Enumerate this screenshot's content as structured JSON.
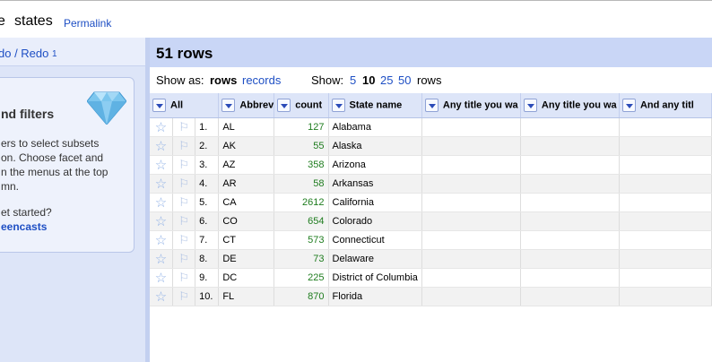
{
  "header": {
    "title_fragment": "e",
    "project_name": "states",
    "permalink_label": "Permalink"
  },
  "left": {
    "undo_redo_label": "do / Redo",
    "undo_count": "1",
    "facet_title": "nd filters",
    "facet_desc_lines": [
      "ers to select subsets",
      " on. Choose facet and",
      "n the menus at the top",
      "mn."
    ],
    "started_text": "et started?",
    "screencasts_label": "eencasts"
  },
  "main": {
    "rows_title": "51 rows",
    "show_as_label": "Show as:",
    "show_as_rows": "rows",
    "show_as_records": "records",
    "show_label": "Show:",
    "page_sizes": [
      "5",
      "10",
      "25",
      "50"
    ],
    "selected_page_size": "10",
    "rows_suffix": "rows"
  },
  "table": {
    "columns": [
      "All",
      "Abbrev",
      "count",
      "State name",
      "Any title you wa",
      "Any title you wa",
      "And any titl"
    ],
    "rows": [
      {
        "index": "1.",
        "abbrev": "AL",
        "count": "127",
        "state": "Alabama"
      },
      {
        "index": "2.",
        "abbrev": "AK",
        "count": "55",
        "state": "Alaska"
      },
      {
        "index": "3.",
        "abbrev": "AZ",
        "count": "358",
        "state": "Arizona"
      },
      {
        "index": "4.",
        "abbrev": "AR",
        "count": "58",
        "state": "Arkansas"
      },
      {
        "index": "5.",
        "abbrev": "CA",
        "count": "2612",
        "state": "California"
      },
      {
        "index": "6.",
        "abbrev": "CO",
        "count": "654",
        "state": "Colorado"
      },
      {
        "index": "7.",
        "abbrev": "CT",
        "count": "573",
        "state": "Connecticut"
      },
      {
        "index": "8.",
        "abbrev": "DE",
        "count": "73",
        "state": "Delaware"
      },
      {
        "index": "9.",
        "abbrev": "DC",
        "count": "225",
        "state": "District of Columbia"
      },
      {
        "index": "10.",
        "abbrev": "FL",
        "count": "870",
        "state": "Florida"
      }
    ]
  },
  "icons": {
    "star": "star-icon",
    "flag": "flag-icon",
    "diamond": "diamond-icon",
    "dropdown": "chevron-down-icon"
  },
  "colors": {
    "link": "#1e4fc4",
    "count_green": "#1e7c1e",
    "header_blue": "#c9d6f6"
  }
}
